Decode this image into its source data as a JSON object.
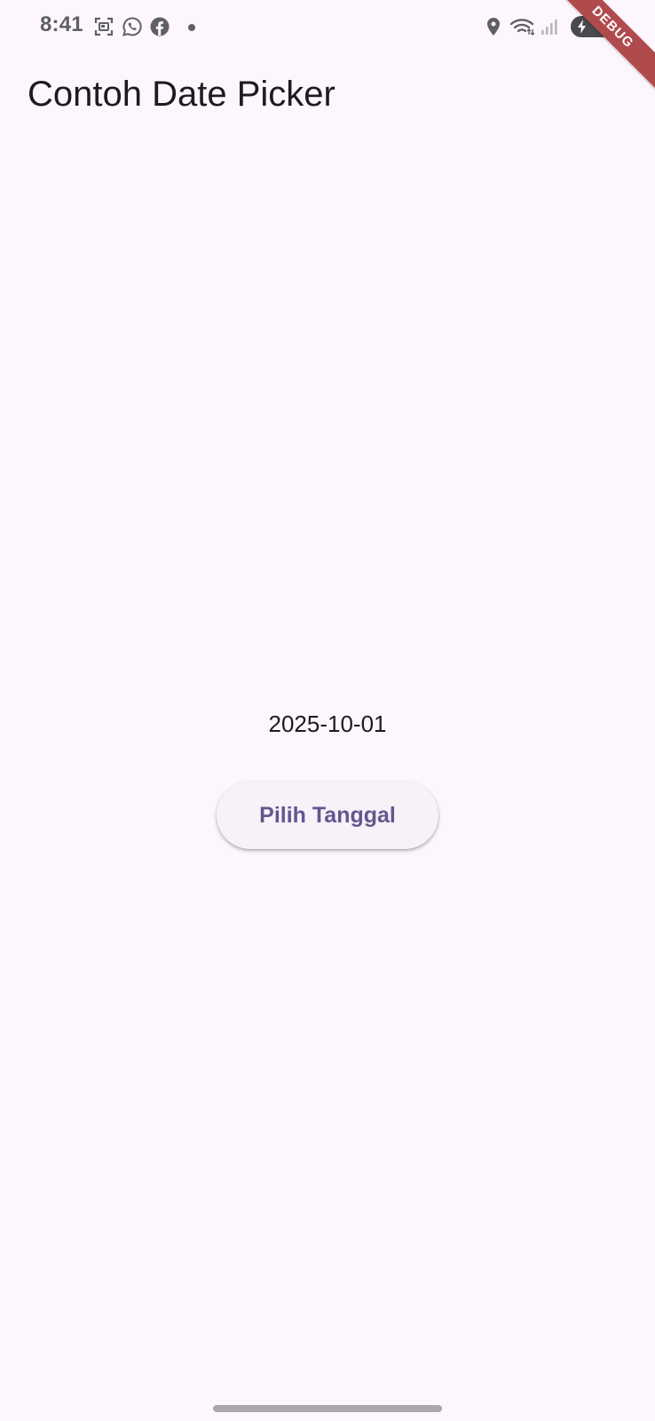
{
  "status_bar": {
    "time": "8:41",
    "icons": [
      "screenshot-icon",
      "whatsapp-icon",
      "facebook-icon",
      "notification-dot-icon",
      "location-icon",
      "wifi-icon",
      "signal-icon",
      "battery-icon"
    ]
  },
  "debug_banner": {
    "label": "DEBUG",
    "color": "#b04a4d"
  },
  "app_bar": {
    "title": "Contoh Date Picker"
  },
  "main": {
    "selected_date": "2025-10-01",
    "pick_button_label": "Pilih Tanggal"
  },
  "colors": {
    "background": "#fdf7fd",
    "button_text": "#65558f",
    "button_bg": "#f7f1f8"
  }
}
